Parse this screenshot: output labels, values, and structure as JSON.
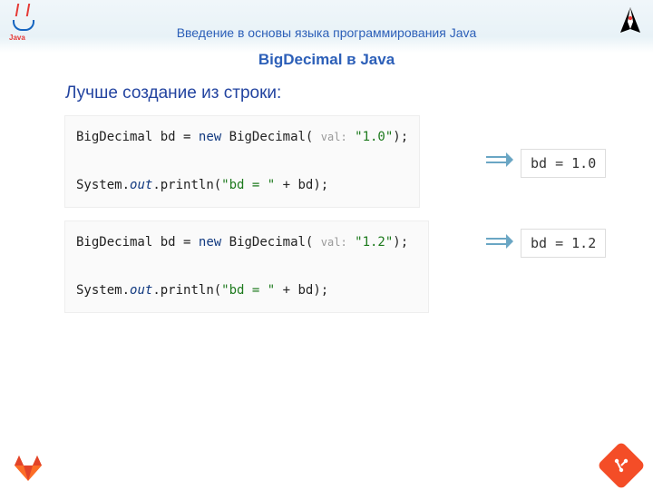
{
  "header": {
    "title": "Введение в основы языка программирования Java"
  },
  "subtitle": "BigDecimal в Java",
  "lead": "Лучше создание из строки:",
  "code1": {
    "type": "BigDecimal",
    "var": "bd",
    "eq": "=",
    "new": "new",
    "ctor": "BigDecimal(",
    "hint": "val:",
    "val": "\"1.0\"",
    "close": ");",
    "line2a": "System.",
    "line2b": "out",
    "line2c": ".println(",
    "line2d": "\"bd = \"",
    "line2e": " + bd);"
  },
  "code2": {
    "type": "BigDecimal",
    "var": "bd",
    "eq": "=",
    "new": "new",
    "ctor": "BigDecimal(",
    "hint": "val:",
    "val": "\"1.2\"",
    "close": ");",
    "line2a": "System.",
    "line2b": "out",
    "line2c": ".println(",
    "line2d": "\"bd = \"",
    "line2e": " + bd);"
  },
  "output1": "bd = 1.0",
  "output2": "bd = 1.2",
  "logos": {
    "java": "Java"
  }
}
